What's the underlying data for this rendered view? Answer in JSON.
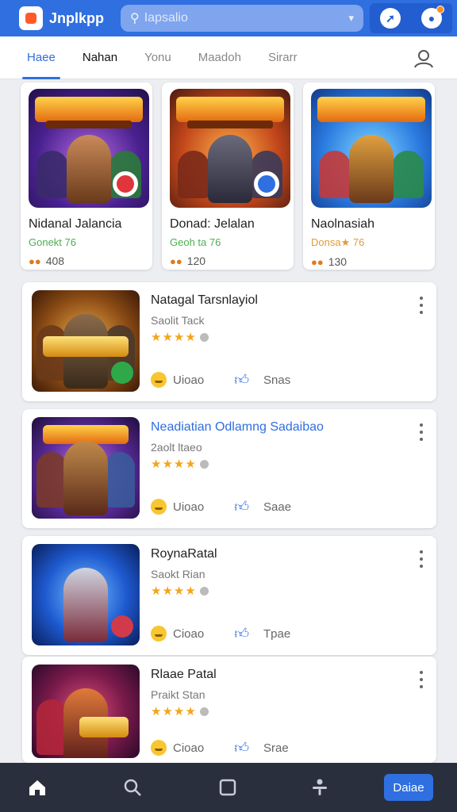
{
  "header": {
    "app_title": "Jnplkpp",
    "search_placeholder": "Iapsalio"
  },
  "tabs": [
    "Haee",
    "Nahan",
    "Yonu",
    "Maadoh",
    "Sirarr"
  ],
  "featured": [
    {
      "title": "Nidanal Jalancia",
      "subtitle": "Gonekt 76",
      "count": "408",
      "banner_text": "JUNARAN",
      "colors": [
        "#6a3bc8",
        "#2a1a6a",
        "#27a33a"
      ]
    },
    {
      "title": "Donad: Jelalan",
      "subtitle": "Geoh ta 76",
      "count": "120",
      "banner_text": "DURNSNAS",
      "colors": [
        "#e4651a",
        "#5b1e10",
        "#2f6fe0"
      ]
    },
    {
      "title": "Naolnasiah",
      "subtitle": "Donsa★ 76",
      "count": "130",
      "banner_text": "SEUBA",
      "colors": [
        "#2aa0e8",
        "#1a3c8a",
        "#e8453a"
      ]
    }
  ],
  "list": [
    {
      "title": "Natagal Tarsnlayiol",
      "subtitle": "Saolit Tack",
      "stars": "★★★★",
      "reaction": "Uioao",
      "action": "Snas",
      "thumb_text": "GAMIAS",
      "colors": [
        "#d4861f",
        "#5a2a0a",
        "#2fa84a"
      ]
    },
    {
      "title": "Neadiatian Odlamng Sadaibao",
      "subtitle": "2aolt ltaeo",
      "stars": "★★★★",
      "reaction": "Uioao",
      "action": "Saae",
      "thumb_text": "SAHOAN",
      "colors": [
        "#7a3cc4",
        "#2a1444",
        "#d9872a"
      ]
    },
    {
      "title": "RoynaRatal",
      "subtitle": "Saokt Rian",
      "stars": "★★★★",
      "reaction": "Cioao",
      "action": "Tpae",
      "thumb_text": "",
      "colors": [
        "#2b7de2",
        "#0e2a6a",
        "#d13a4a"
      ]
    },
    {
      "title": "Rlaae Patal",
      "subtitle": "Praikt Stan",
      "stars": "★★★★",
      "reaction": "Cioao",
      "action": "Srae",
      "thumb_text": "EXETA",
      "colors": [
        "#b3263a",
        "#3a1030",
        "#e7a62a"
      ]
    }
  ],
  "bottom_nav": {
    "cta_label": "Daiae"
  }
}
